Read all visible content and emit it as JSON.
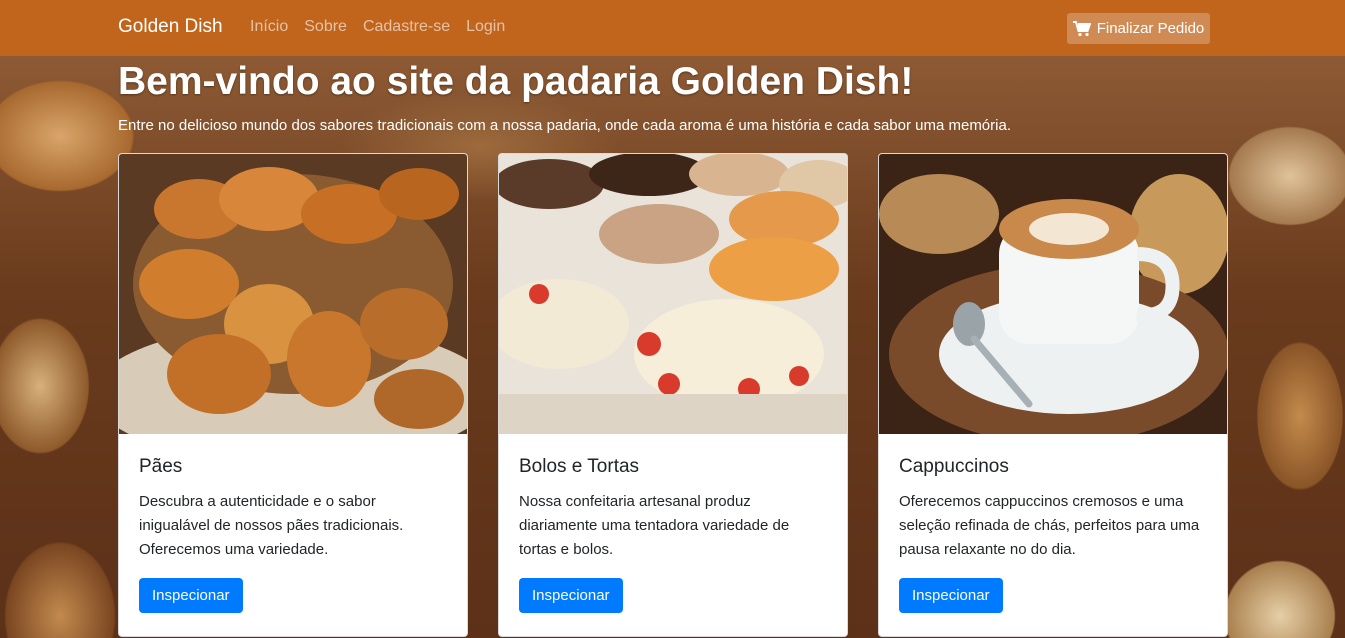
{
  "navbar": {
    "brand": "Golden Dish",
    "links": [
      "Início",
      "Sobre",
      "Cadastre-se",
      "Login"
    ],
    "order_button": "Finalizar Pedido",
    "order_icon": "shopping-cart-icon",
    "background_color": "#c1651c"
  },
  "hero": {
    "title": "Bem-vindo ao site da padaria Golden Dish!",
    "subtitle": "Entre no delicioso mundo dos sabores tradicionais com a nossa padaria, onde cada aroma é uma história e cada sabor uma memória."
  },
  "cards": [
    {
      "title": "Pães",
      "text": "Descubra a autenticidade e o sabor inigualável de nossos pães tradicionais. Oferecemos uma variedade.",
      "button": "Inspecionar",
      "image": "bread-basket-photo"
    },
    {
      "title": "Bolos e Tortas",
      "text": "Nossa confeitaria artesanal produz diariamente uma tentadora variedade de tortas e bolos.",
      "button": "Inspecionar",
      "image": "cakes-and-tarts-photo"
    },
    {
      "title": "Cappuccinos",
      "text": "Oferecemos cappuccinos cremosos e uma seleção refinada de chás, perfeitos para uma pausa relaxante no do dia.",
      "button": "Inspecionar",
      "image": "cappuccino-cup-photo"
    }
  ],
  "colors": {
    "button": "#007bff"
  }
}
